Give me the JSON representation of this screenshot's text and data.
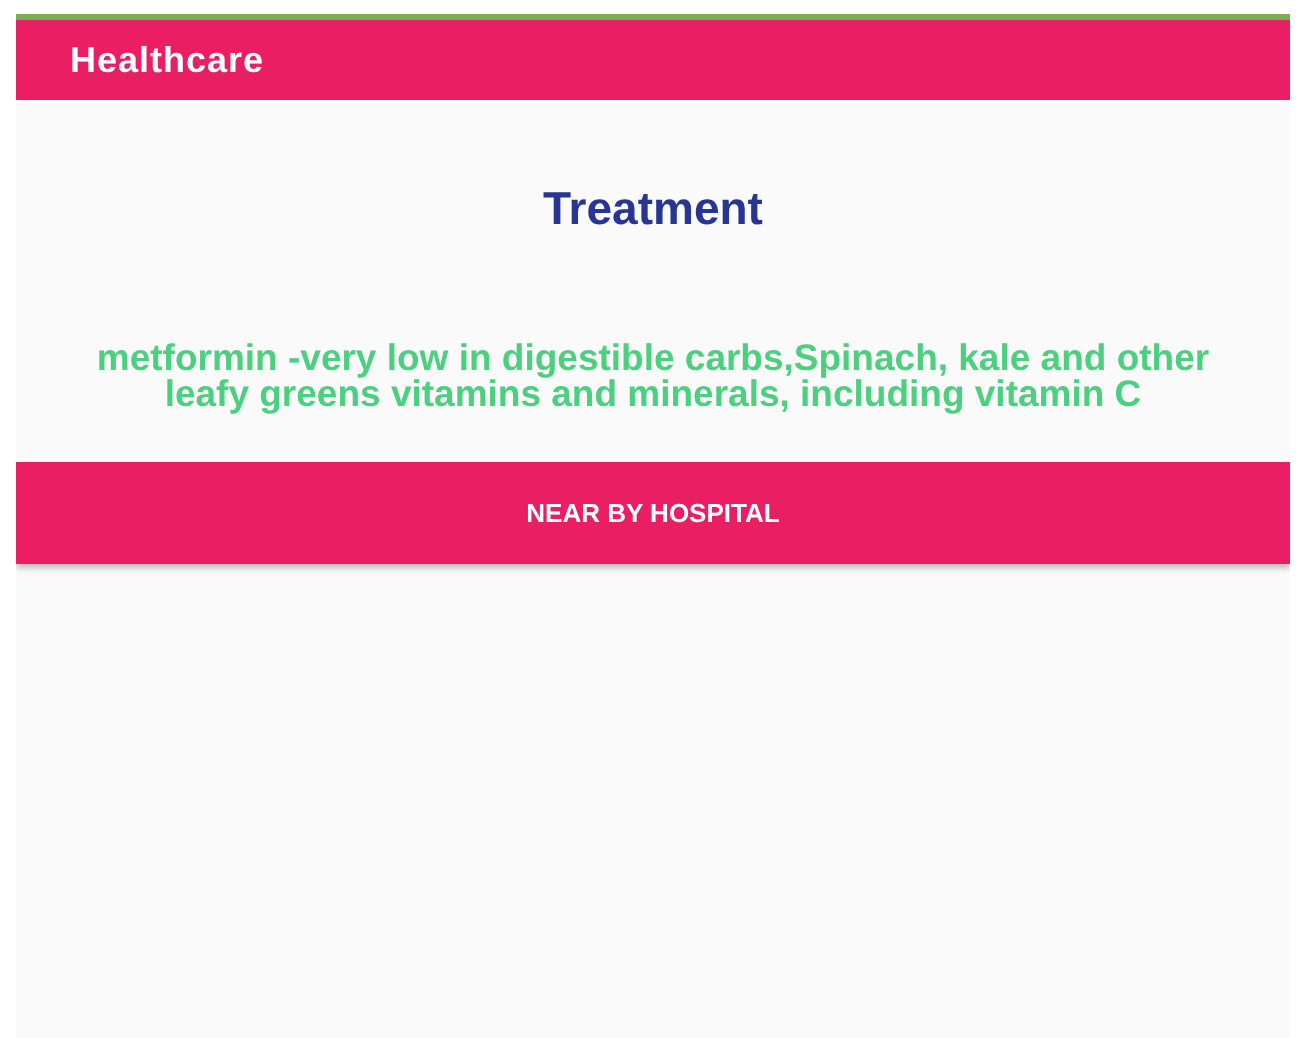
{
  "app_bar": {
    "title": "Healthcare"
  },
  "heading": "Treatment",
  "description": "metformin -very low in digestible carbs,Spinach, kale and other leafy greens vitamins and minerals, including vitamin C",
  "buttons": [
    {
      "label": "NEAR BY HOSPITAL"
    }
  ]
}
